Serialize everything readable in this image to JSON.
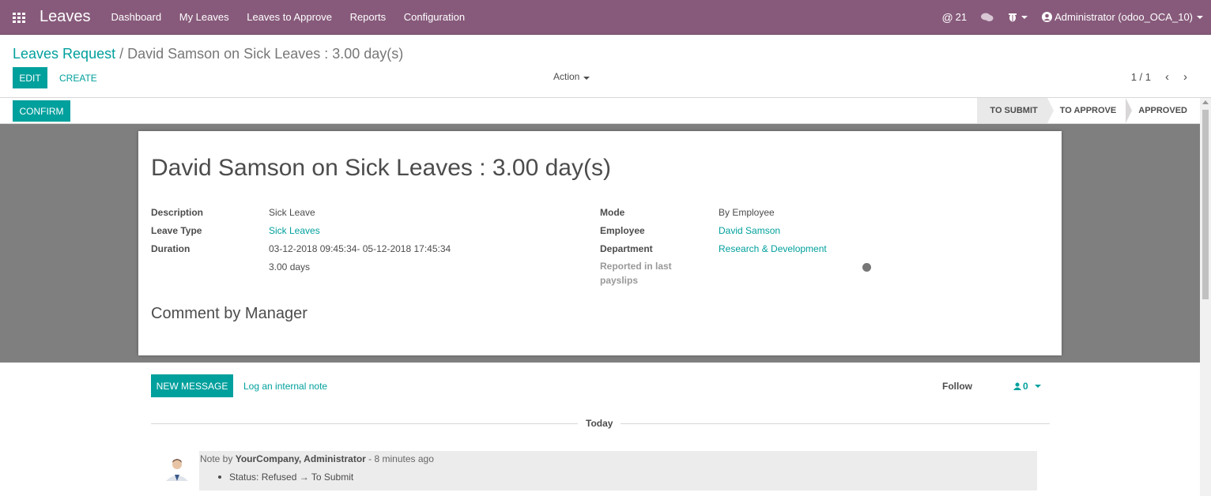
{
  "navbar": {
    "app_name": "Leaves",
    "menu": [
      "Dashboard",
      "My Leaves",
      "Leaves to Approve",
      "Reports",
      "Configuration"
    ],
    "mentions_count": "21",
    "user": "Administrator (odoo_OCA_10)"
  },
  "control": {
    "breadcrumb_root": "Leaves Request",
    "breadcrumb_sep": "/",
    "breadcrumb_current": "David Samson on Sick Leaves : 3.00 day(s)",
    "edit_label": "EDIT",
    "create_label": "CREATE",
    "action_label": "Action",
    "pager": "1 / 1"
  },
  "statusbar": {
    "confirm_label": "CONFIRM",
    "stages": [
      "TO SUBMIT",
      "TO APPROVE",
      "APPROVED"
    ],
    "active_stage": "TO SUBMIT"
  },
  "form": {
    "title": "David Samson on Sick Leaves : 3.00 day(s)",
    "description_label": "Description",
    "description_value": "Sick Leave",
    "leave_type_label": "Leave Type",
    "leave_type_value": "Sick Leaves",
    "duration_label": "Duration",
    "duration_dates": "03-12-2018 09:45:34- 05-12-2018 17:45:34",
    "duration_days": "3.00 days",
    "mode_label": "Mode",
    "mode_value": "By Employee",
    "employee_label": "Employee",
    "employee_value": "David Samson",
    "department_label": "Department",
    "department_value": "Research & Development",
    "reported_label": "Reported in last payslips",
    "comment_title": "Comment by Manager"
  },
  "chatter": {
    "new_message_label": "NEW MESSAGE",
    "log_note_label": "Log an internal note",
    "follow_label": "Follow",
    "followers_count": "0",
    "date_separator": "Today",
    "message": {
      "prefix": "Note by",
      "author": "YourCompany, Administrator",
      "time": "- 8 minutes ago",
      "tracking": "Status: Refused → To Submit"
    }
  },
  "colors": {
    "navbar": "#875a7b",
    "primary": "#00a09d",
    "sheet_bg": "#7f7f7f"
  }
}
